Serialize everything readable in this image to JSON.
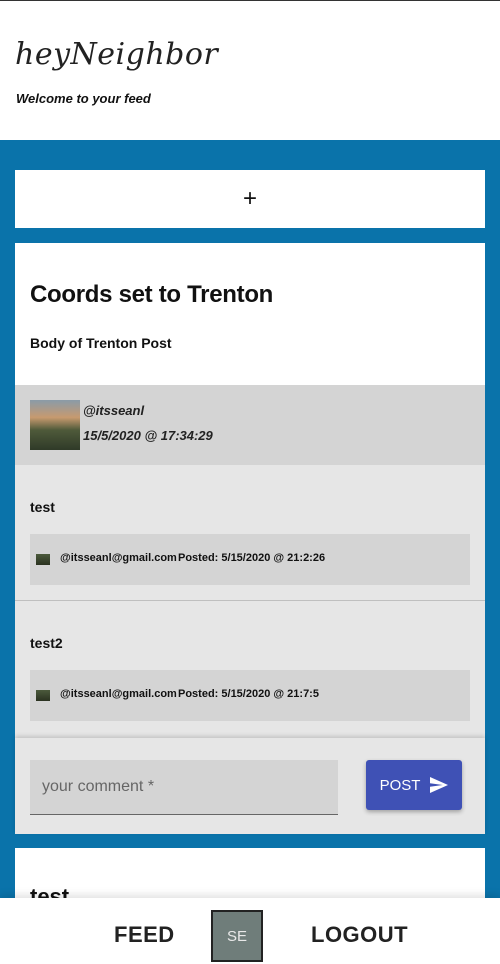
{
  "header": {
    "brand": "heyNeighbor",
    "subtitle": "Welcome to your feed"
  },
  "add_post": {
    "label": "+"
  },
  "post": {
    "title": "Coords set to Trenton",
    "body": "Body of Trenton Post",
    "author": {
      "handle": "@itsseanl",
      "date": "15/5/2020 @ 17:34:29"
    },
    "comments": [
      {
        "text": "test",
        "email": "@itsseanl@gmail.com",
        "posted": "Posted: 5/15/2020 @ 21:2:26"
      },
      {
        "text": "test2",
        "email": "@itsseanl@gmail.com",
        "posted": "Posted: 5/15/2020 @ 21:7:5"
      }
    ],
    "comment_form": {
      "placeholder": "your comment *",
      "value": "",
      "submit_label": "POST"
    }
  },
  "next_post": {
    "title": "test"
  },
  "nav": {
    "feed_label": "FEED",
    "avatar_initials": "SE",
    "logout_label": "LOGOUT"
  }
}
